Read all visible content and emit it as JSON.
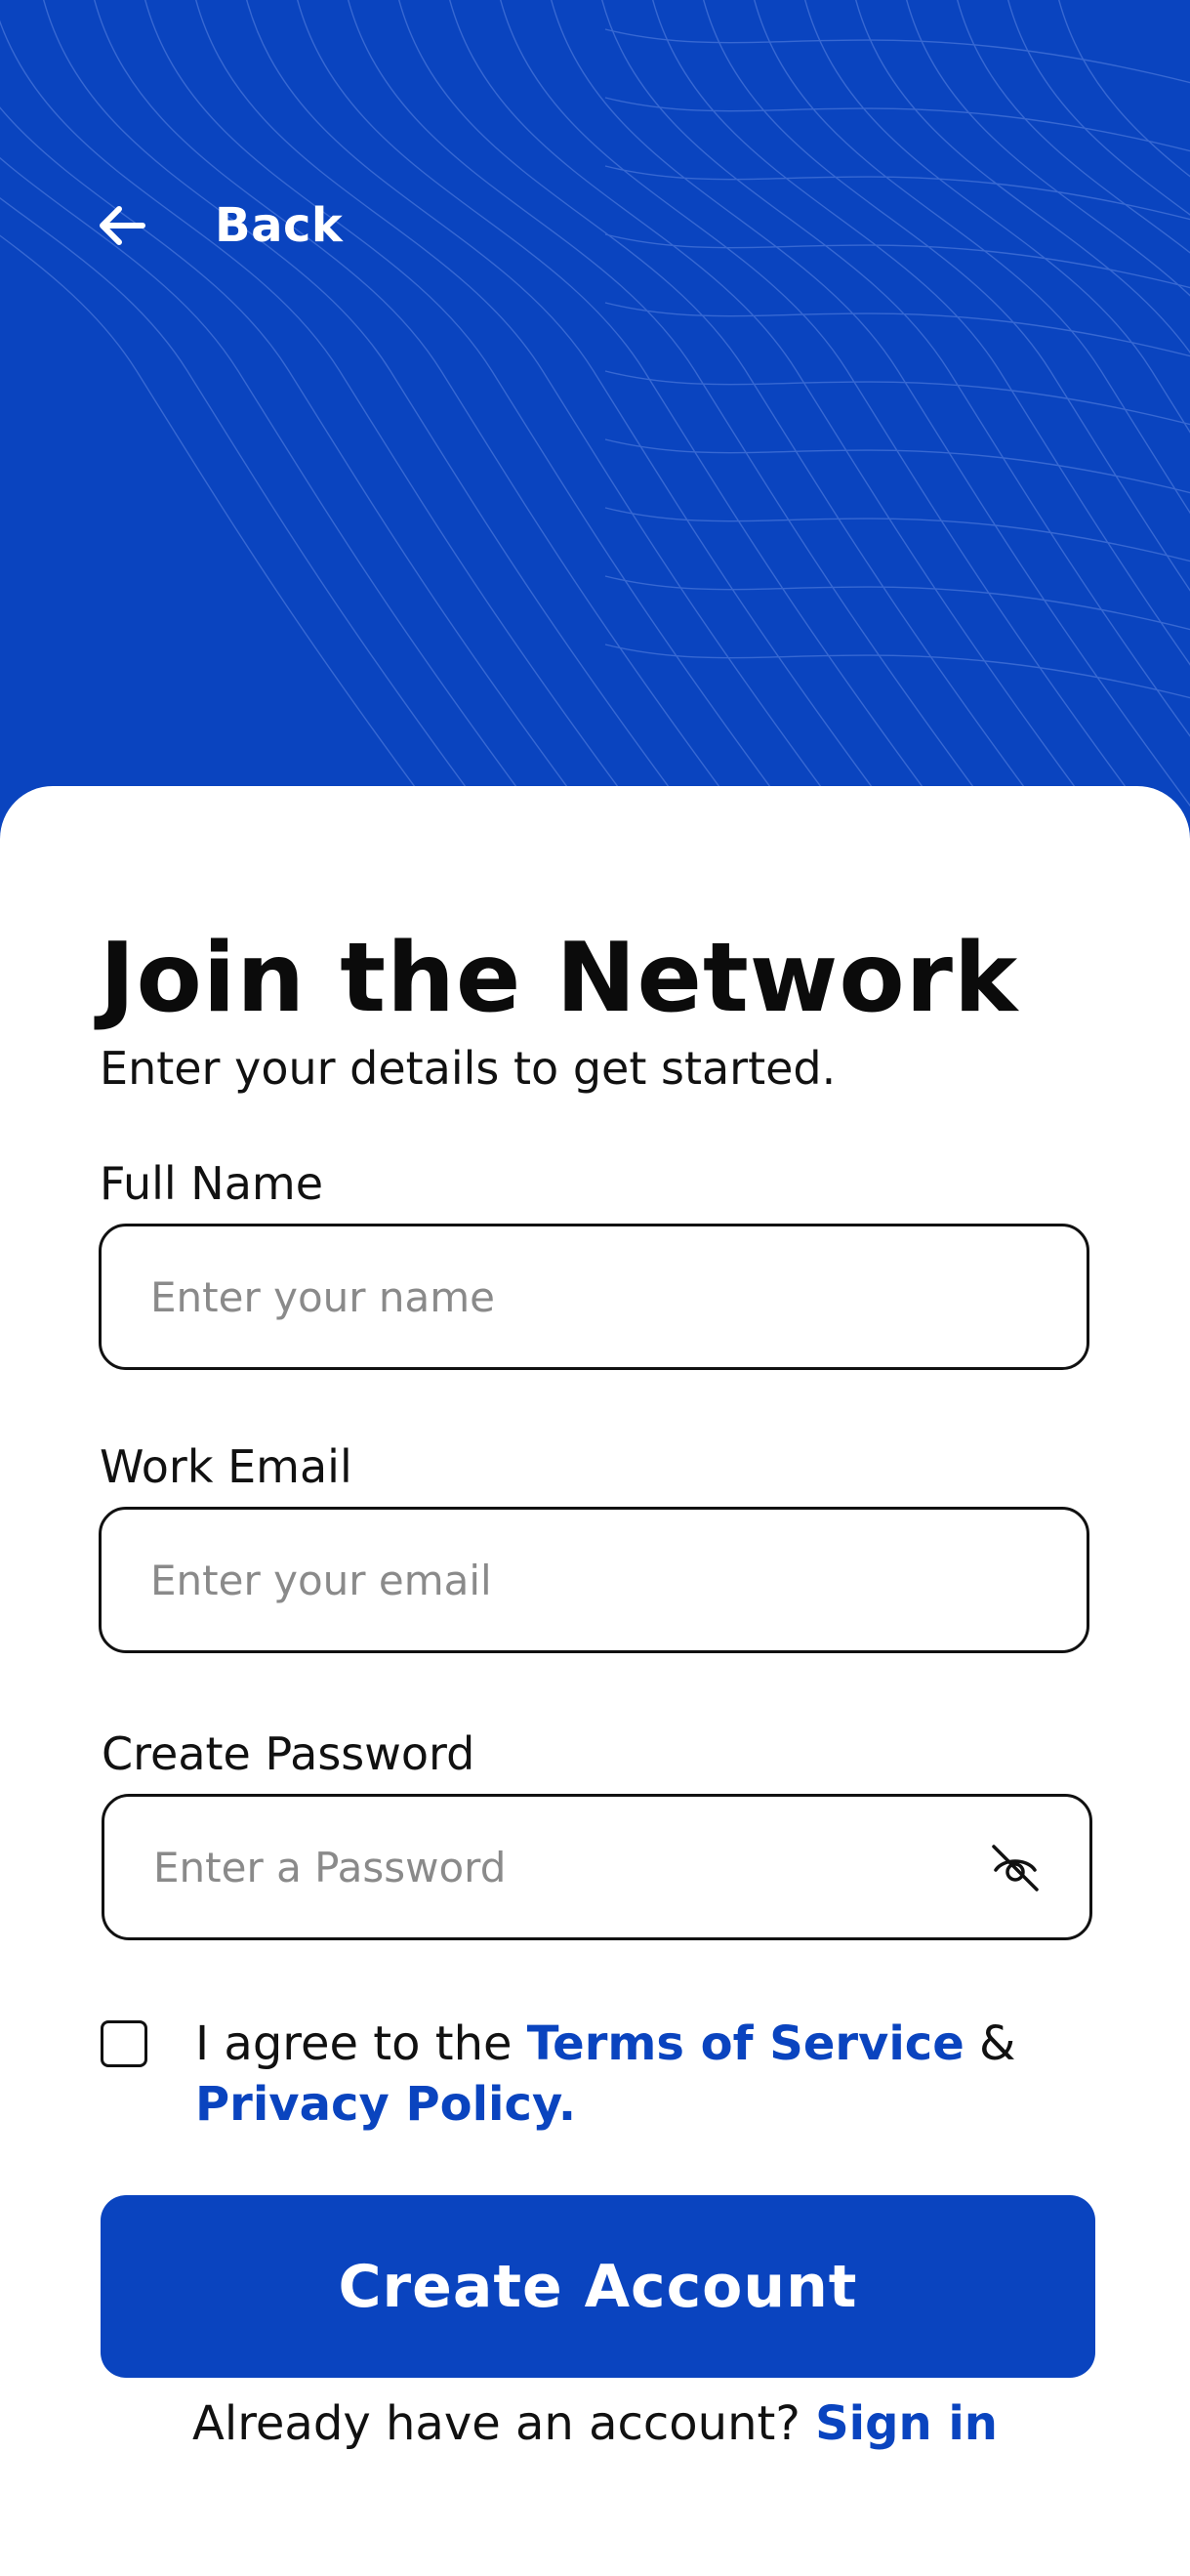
{
  "header": {
    "back_label": "Back",
    "back_icon": "arrow-left-icon",
    "background_color": "#0a44bf"
  },
  "form": {
    "title": "Join the Network",
    "subtitle": "Enter your details to get started.",
    "full_name": {
      "label": "Full Name",
      "placeholder": "Enter your name",
      "value": ""
    },
    "email": {
      "label": "Work Email",
      "placeholder": "Enter your email",
      "value": ""
    },
    "password": {
      "label": "Create Password",
      "placeholder": "Enter a Password",
      "value": "",
      "visibility_icon": "eye-off-icon"
    },
    "agreement": {
      "checked": false,
      "prefix": "I agree to the ",
      "terms_link": "Terms of Service",
      "joiner": " & ",
      "privacy_link": "Privacy Policy."
    },
    "submit_label": "Create Account",
    "signin_prompt": "Already have an account? ",
    "signin_link": "Sign in"
  },
  "colors": {
    "accent": "#0a44bf",
    "text": "#111111",
    "placeholder": "#8a8a8a",
    "card": "#ffffff"
  }
}
